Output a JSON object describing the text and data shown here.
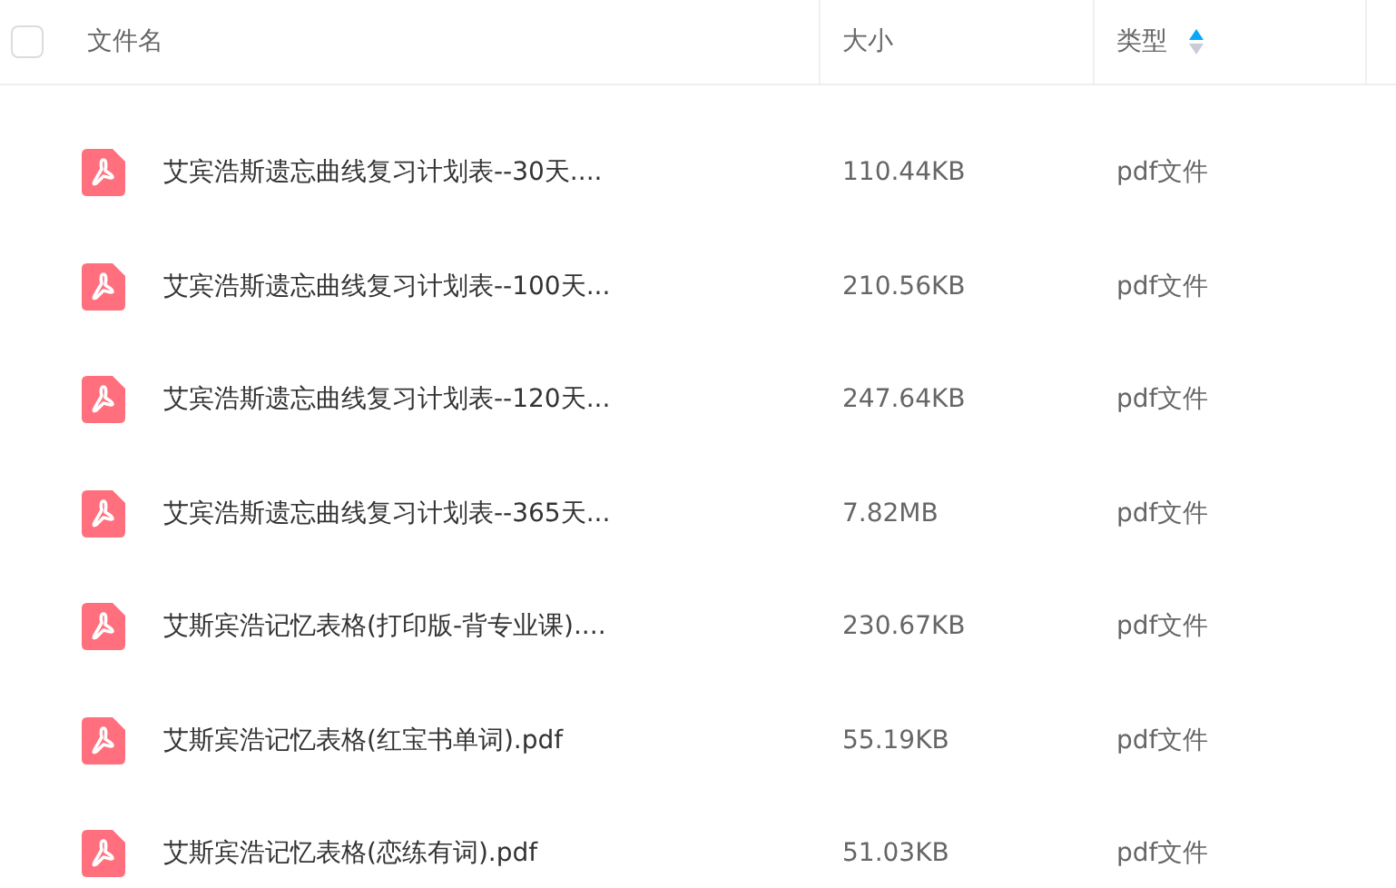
{
  "header": {
    "select_all": {
      "checked": false
    },
    "columns": [
      {
        "label": "文件名"
      },
      {
        "label": "大小"
      },
      {
        "label": "类型",
        "sorted": true
      }
    ]
  },
  "rows": [
    {
      "name": "艾宾浩斯遗忘曲线复习计划表--30天....",
      "size": "110.44KB",
      "type": "pdf文件"
    },
    {
      "name": "艾宾浩斯遗忘曲线复习计划表--100天...",
      "size": "210.56KB",
      "type": "pdf文件"
    },
    {
      "name": "艾宾浩斯遗忘曲线复习计划表--120天...",
      "size": "247.64KB",
      "type": "pdf文件"
    },
    {
      "name": "艾宾浩斯遗忘曲线复习计划表--365天...",
      "size": "7.82MB",
      "type": "pdf文件"
    },
    {
      "name": "艾斯宾浩记忆表格(打印版-背专业课)....",
      "size": "230.67KB",
      "type": "pdf文件"
    },
    {
      "name": "艾斯宾浩记忆表格(红宝书单词).pdf",
      "size": "55.19KB",
      "type": "pdf文件"
    },
    {
      "name": "艾斯宾浩记忆表格(恋练有词).pdf",
      "size": "51.03KB",
      "type": "pdf文件"
    }
  ]
}
